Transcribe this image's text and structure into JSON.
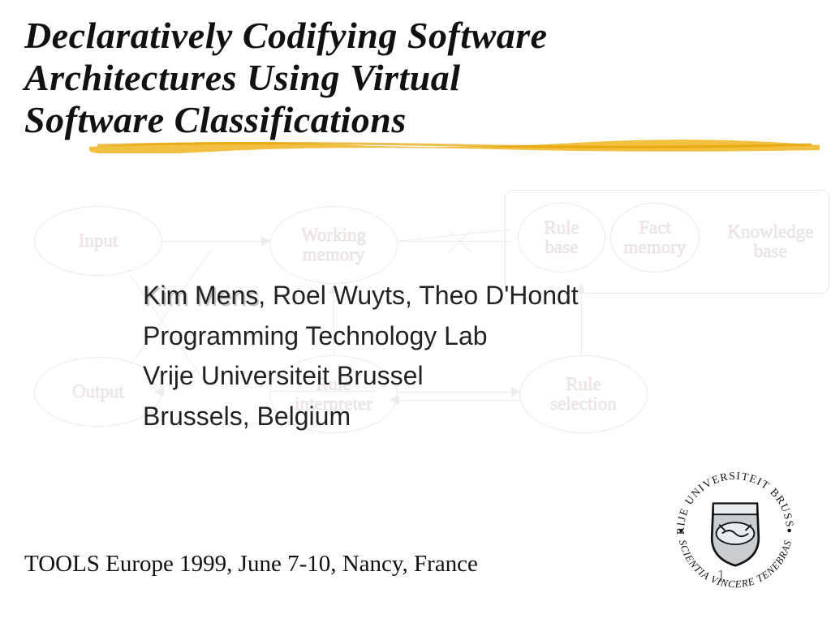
{
  "title": "Declaratively Codifying Software\nArchitectures Using Virtual\nSoftware Classifications",
  "authors": {
    "emphasized_name": "Kim Mens",
    "rest_of_line1": ", Roel Wuyts, Theo D'Hondt",
    "line2": "Programming Technology Lab",
    "line3": "Vrije Universiteit Brussel",
    "line4": "Brussels, Belgium"
  },
  "conference": "TOOLS Europe 1999, June 7-10, Nancy, France",
  "slide_number": "1",
  "seal": {
    "top_text": "VRIJE UNIVERSITEIT BRUSSEL",
    "bottom_text": "SCIENTIA VINCERE TENEBRAS"
  },
  "diagram": {
    "nodes": {
      "input": "Input",
      "output": "Output",
      "working_memory": "Working\nmemory",
      "rule_interpreter": "Rule\ninterpreter",
      "rule_base": "Rule\nbase",
      "fact_memory": "Fact\nmemory",
      "knowledge_base": "Knowledge\nbase",
      "rule_selection": "Rule\nselection"
    }
  }
}
